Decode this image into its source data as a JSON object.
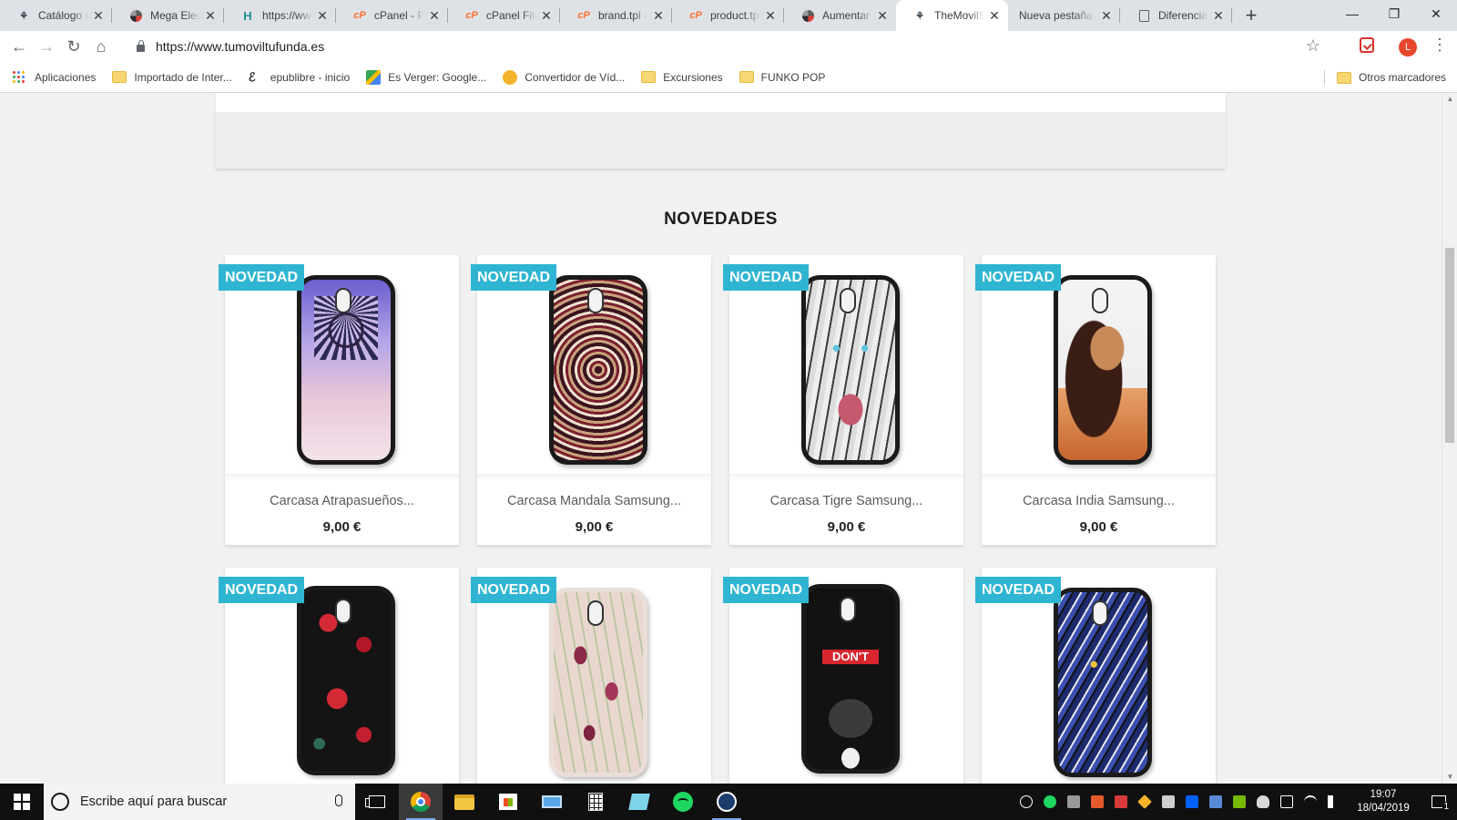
{
  "browser": {
    "tabs": [
      {
        "title": "Catálogo de productos",
        "favicon": "prestashop-icon",
        "active": false
      },
      {
        "title": "Mega Electrónica",
        "favicon": "swirl-icon",
        "active": false
      },
      {
        "title": "https://www",
        "favicon": "h-icon",
        "active": false
      },
      {
        "title": "cPanel - Principal",
        "favicon": "cpanel-icon",
        "active": false
      },
      {
        "title": "cPanel File Manager",
        "favicon": "cpanel-icon",
        "active": false
      },
      {
        "title": "brand.tpl - ",
        "favicon": "cpanel-icon",
        "active": false
      },
      {
        "title": "product.tpl",
        "favicon": "cpanel-icon",
        "active": false
      },
      {
        "title": "Aumentar la",
        "favicon": "swirl-icon",
        "active": false
      },
      {
        "title": "TheMovilShop",
        "favicon": "prestashop-icon",
        "active": true
      },
      {
        "title": "Nueva pestaña",
        "favicon": "none",
        "active": false
      },
      {
        "title": "Diferencia entre",
        "favicon": "document-icon",
        "active": false
      }
    ],
    "url": "https://www.tumoviltufunda.es",
    "profile_initial": "L",
    "bookmarks": [
      {
        "label": "Aplicaciones",
        "icon": "apps-grid-icon"
      },
      {
        "label": "Importado de Inter...",
        "icon": "folder-icon"
      },
      {
        "label": "epublibre - inicio",
        "icon": "epublibre-icon"
      },
      {
        "label": "Es Verger: Google...",
        "icon": "google-maps-icon"
      },
      {
        "label": "Convertidor de Víd...",
        "icon": "converter-icon"
      },
      {
        "label": "Excursiones",
        "icon": "folder-icon"
      },
      {
        "label": "FUNKO POP",
        "icon": "folder-icon"
      }
    ],
    "other_bookmarks": "Otros marcadores"
  },
  "page": {
    "section_title": "NOVEDADES",
    "badge_label": "NOVEDAD",
    "products": [
      {
        "name": "Carcasa Atrapasueños...",
        "price": "9,00 €",
        "art": "dreamcatcher"
      },
      {
        "name": "Carcasa Mandala Samsung...",
        "price": "9,00 €",
        "art": "mandala"
      },
      {
        "name": "Carcasa Tigre Samsung...",
        "price": "9,00 €",
        "art": "tiger"
      },
      {
        "name": "Carcasa India Samsung...",
        "price": "9,00 €",
        "art": "india"
      },
      {
        "name": "",
        "price": "",
        "art": "red-roses"
      },
      {
        "name": "",
        "price": "",
        "art": "tulips"
      },
      {
        "name": "",
        "price": "",
        "art": "dont-touch-dog"
      },
      {
        "name": "",
        "price": "",
        "art": "blue-tiger"
      }
    ],
    "dont_text": "DON'T"
  },
  "taskbar": {
    "search_placeholder": "Escribe aquí para buscar",
    "time": "19:07",
    "date": "18/04/2019",
    "notification_count": "1"
  },
  "colors": {
    "badge": "#2fb5d2",
    "page_bg": "#f1f1f1"
  }
}
